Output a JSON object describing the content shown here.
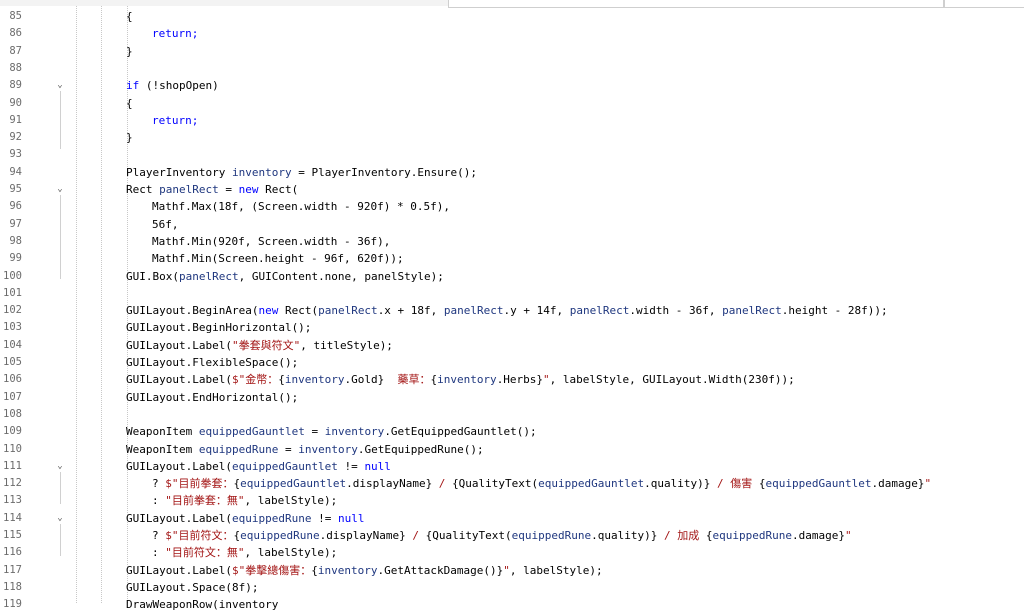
{
  "colors": {
    "keyword": "#0000ff",
    "string": "#a31515",
    "variable": "#1f377f",
    "plain": "#000000",
    "line_number": "#6c6c6c",
    "background": "#ffffff"
  },
  "lines": [
    {
      "number": "85",
      "fold": "",
      "indent": 0,
      "tokens": [
        {
          "t": "{",
          "c": "plain"
        }
      ]
    },
    {
      "number": "86",
      "fold": "",
      "indent": 1,
      "tokens": [
        {
          "t": "return;",
          "c": "kw"
        }
      ]
    },
    {
      "number": "87",
      "fold": "",
      "indent": 0,
      "tokens": [
        {
          "t": "}",
          "c": "plain"
        }
      ]
    },
    {
      "number": "88",
      "fold": "",
      "indent": 0,
      "tokens": []
    },
    {
      "number": "89",
      "fold": "⌄",
      "indent": 0,
      "tokens": [
        {
          "t": "if",
          "c": "kw"
        },
        {
          "t": " (!shopOpen)",
          "c": "plain"
        }
      ]
    },
    {
      "number": "90",
      "fold": "",
      "indent": 0,
      "tokens": [
        {
          "t": "{",
          "c": "plain"
        }
      ]
    },
    {
      "number": "91",
      "fold": "",
      "indent": 1,
      "tokens": [
        {
          "t": "return;",
          "c": "kw"
        }
      ]
    },
    {
      "number": "92",
      "fold": "",
      "indent": 0,
      "tokens": [
        {
          "t": "}",
          "c": "plain"
        }
      ]
    },
    {
      "number": "93",
      "fold": "",
      "indent": 0,
      "tokens": []
    },
    {
      "number": "94",
      "fold": "",
      "indent": 0,
      "tokens": [
        {
          "t": "PlayerInventory ",
          "c": "plain"
        },
        {
          "t": "inventory",
          "c": "var"
        },
        {
          "t": " = PlayerInventory.Ensure();",
          "c": "plain"
        }
      ]
    },
    {
      "number": "95",
      "fold": "⌄",
      "indent": 0,
      "tokens": [
        {
          "t": "Rect ",
          "c": "plain"
        },
        {
          "t": "panelRect",
          "c": "var"
        },
        {
          "t": " = ",
          "c": "plain"
        },
        {
          "t": "new",
          "c": "kw"
        },
        {
          "t": " Rect(",
          "c": "plain"
        }
      ]
    },
    {
      "number": "96",
      "fold": "",
      "indent": 1,
      "tokens": [
        {
          "t": "Mathf.Max(18f, (Screen.width - 920f) * 0.5f),",
          "c": "plain"
        }
      ]
    },
    {
      "number": "97",
      "fold": "",
      "indent": 1,
      "tokens": [
        {
          "t": "56f,",
          "c": "plain"
        }
      ]
    },
    {
      "number": "98",
      "fold": "",
      "indent": 1,
      "tokens": [
        {
          "t": "Mathf.Min(920f, Screen.width - 36f),",
          "c": "plain"
        }
      ]
    },
    {
      "number": "99",
      "fold": "",
      "indent": 1,
      "tokens": [
        {
          "t": "Mathf.Min(Screen.height - 96f, 620f));",
          "c": "plain"
        }
      ]
    },
    {
      "number": "100",
      "fold": "",
      "indent": 0,
      "tokens": [
        {
          "t": "GUI.Box(",
          "c": "plain"
        },
        {
          "t": "panelRect",
          "c": "var"
        },
        {
          "t": ", GUIContent.none, panelStyle);",
          "c": "plain"
        }
      ]
    },
    {
      "number": "101",
      "fold": "",
      "indent": 0,
      "tokens": []
    },
    {
      "number": "102",
      "fold": "",
      "indent": 0,
      "tokens": [
        {
          "t": "GUILayout.BeginArea(",
          "c": "plain"
        },
        {
          "t": "new",
          "c": "kw"
        },
        {
          "t": " Rect(",
          "c": "plain"
        },
        {
          "t": "panelRect",
          "c": "var"
        },
        {
          "t": ".x + 18f, ",
          "c": "plain"
        },
        {
          "t": "panelRect",
          "c": "var"
        },
        {
          "t": ".y + 14f, ",
          "c": "plain"
        },
        {
          "t": "panelRect",
          "c": "var"
        },
        {
          "t": ".width - 36f, ",
          "c": "plain"
        },
        {
          "t": "panelRect",
          "c": "var"
        },
        {
          "t": ".height - 28f));",
          "c": "plain"
        }
      ]
    },
    {
      "number": "103",
      "fold": "",
      "indent": 0,
      "tokens": [
        {
          "t": "GUILayout.BeginHorizontal();",
          "c": "plain"
        }
      ]
    },
    {
      "number": "104",
      "fold": "",
      "indent": 0,
      "tokens": [
        {
          "t": "GUILayout.Label(",
          "c": "plain"
        },
        {
          "t": "\"拳套與符文\"",
          "c": "str"
        },
        {
          "t": ", titleStyle);",
          "c": "plain"
        }
      ]
    },
    {
      "number": "105",
      "fold": "",
      "indent": 0,
      "tokens": [
        {
          "t": "GUILayout.FlexibleSpace();",
          "c": "plain"
        }
      ]
    },
    {
      "number": "106",
      "fold": "",
      "indent": 0,
      "tokens": [
        {
          "t": "GUILayout.Label(",
          "c": "plain"
        },
        {
          "t": "$\"金幣：",
          "c": "str"
        },
        {
          "t": "{",
          "c": "plain"
        },
        {
          "t": "inventory",
          "c": "var"
        },
        {
          "t": ".Gold}",
          "c": "plain"
        },
        {
          "t": "  藥草：",
          "c": "str"
        },
        {
          "t": "{",
          "c": "plain"
        },
        {
          "t": "inventory",
          "c": "var"
        },
        {
          "t": ".Herbs}",
          "c": "plain"
        },
        {
          "t": "\"",
          "c": "str"
        },
        {
          "t": ", labelStyle, GUILayout.Width(230f));",
          "c": "plain"
        }
      ]
    },
    {
      "number": "107",
      "fold": "",
      "indent": 0,
      "tokens": [
        {
          "t": "GUILayout.EndHorizontal();",
          "c": "plain"
        }
      ]
    },
    {
      "number": "108",
      "fold": "",
      "indent": 0,
      "tokens": []
    },
    {
      "number": "109",
      "fold": "",
      "indent": 0,
      "tokens": [
        {
          "t": "WeaponItem ",
          "c": "plain"
        },
        {
          "t": "equippedGauntlet",
          "c": "var"
        },
        {
          "t": " = ",
          "c": "plain"
        },
        {
          "t": "inventory",
          "c": "var"
        },
        {
          "t": ".GetEquippedGauntlet();",
          "c": "plain"
        }
      ]
    },
    {
      "number": "110",
      "fold": "",
      "indent": 0,
      "tokens": [
        {
          "t": "WeaponItem ",
          "c": "plain"
        },
        {
          "t": "equippedRune",
          "c": "var"
        },
        {
          "t": " = ",
          "c": "plain"
        },
        {
          "t": "inventory",
          "c": "var"
        },
        {
          "t": ".GetEquippedRune();",
          "c": "plain"
        }
      ]
    },
    {
      "number": "111",
      "fold": "⌄",
      "indent": 0,
      "tokens": [
        {
          "t": "GUILayout.Label(",
          "c": "plain"
        },
        {
          "t": "equippedGauntlet",
          "c": "var"
        },
        {
          "t": " != ",
          "c": "plain"
        },
        {
          "t": "null",
          "c": "kw"
        }
      ]
    },
    {
      "number": "112",
      "fold": "",
      "indent": 1,
      "tokens": [
        {
          "t": "? ",
          "c": "plain"
        },
        {
          "t": "$\"目前拳套：",
          "c": "str"
        },
        {
          "t": "{",
          "c": "plain"
        },
        {
          "t": "equippedGauntlet",
          "c": "var"
        },
        {
          "t": ".displayName}",
          "c": "plain"
        },
        {
          "t": " / ",
          "c": "str"
        },
        {
          "t": "{QualityText(",
          "c": "plain"
        },
        {
          "t": "equippedGauntlet",
          "c": "var"
        },
        {
          "t": ".quality)}",
          "c": "plain"
        },
        {
          "t": " / 傷害 ",
          "c": "str"
        },
        {
          "t": "{",
          "c": "plain"
        },
        {
          "t": "equippedGauntlet",
          "c": "var"
        },
        {
          "t": ".damage}",
          "c": "plain"
        },
        {
          "t": "\"",
          "c": "str"
        }
      ]
    },
    {
      "number": "113",
      "fold": "",
      "indent": 1,
      "tokens": [
        {
          "t": ": ",
          "c": "plain"
        },
        {
          "t": "\"目前拳套：無\"",
          "c": "str"
        },
        {
          "t": ", labelStyle);",
          "c": "plain"
        }
      ]
    },
    {
      "number": "114",
      "fold": "⌄",
      "indent": 0,
      "tokens": [
        {
          "t": "GUILayout.Label(",
          "c": "plain"
        },
        {
          "t": "equippedRune",
          "c": "var"
        },
        {
          "t": " != ",
          "c": "plain"
        },
        {
          "t": "null",
          "c": "kw"
        }
      ]
    },
    {
      "number": "115",
      "fold": "",
      "indent": 1,
      "tokens": [
        {
          "t": "? ",
          "c": "plain"
        },
        {
          "t": "$\"目前符文：",
          "c": "str"
        },
        {
          "t": "{",
          "c": "plain"
        },
        {
          "t": "equippedRune",
          "c": "var"
        },
        {
          "t": ".displayName}",
          "c": "plain"
        },
        {
          "t": " / ",
          "c": "str"
        },
        {
          "t": "{QualityText(",
          "c": "plain"
        },
        {
          "t": "equippedRune",
          "c": "var"
        },
        {
          "t": ".quality)}",
          "c": "plain"
        },
        {
          "t": " / 加成 ",
          "c": "str"
        },
        {
          "t": "{",
          "c": "plain"
        },
        {
          "t": "equippedRune",
          "c": "var"
        },
        {
          "t": ".damage}",
          "c": "plain"
        },
        {
          "t": "\"",
          "c": "str"
        }
      ]
    },
    {
      "number": "116",
      "fold": "",
      "indent": 1,
      "tokens": [
        {
          "t": ": ",
          "c": "plain"
        },
        {
          "t": "\"目前符文：無\"",
          "c": "str"
        },
        {
          "t": ", labelStyle);",
          "c": "plain"
        }
      ]
    },
    {
      "number": "117",
      "fold": "",
      "indent": 0,
      "tokens": [
        {
          "t": "GUILayout.Label(",
          "c": "plain"
        },
        {
          "t": "$\"拳擊總傷害：",
          "c": "str"
        },
        {
          "t": "{",
          "c": "plain"
        },
        {
          "t": "inventory",
          "c": "var"
        },
        {
          "t": ".GetAttackDamage()}",
          "c": "plain"
        },
        {
          "t": "\"",
          "c": "str"
        },
        {
          "t": ", labelStyle);",
          "c": "plain"
        }
      ]
    },
    {
      "number": "118",
      "fold": "",
      "indent": 0,
      "tokens": [
        {
          "t": "GUILayout.Space(8f);",
          "c": "plain"
        }
      ]
    },
    {
      "number": "119",
      "fold": "",
      "indent": 0,
      "tokens": [
        {
          "t": "DrawWeaponRow(inventory",
          "c": "plain"
        }
      ]
    }
  ]
}
